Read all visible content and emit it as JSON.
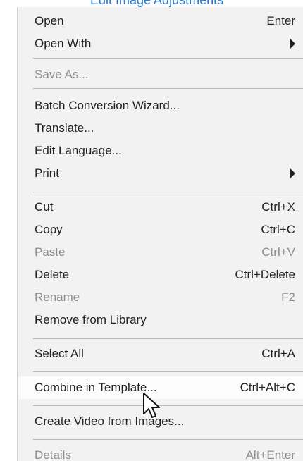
{
  "header_text": "Edit Image Adjustments",
  "menu": {
    "items": [
      {
        "label": "Open",
        "shortcut": "Enter"
      },
      {
        "label": "Open With",
        "submenu": true
      },
      {
        "label": "Save As...",
        "disabled": true
      },
      {
        "label": "Batch Conversion Wizard..."
      },
      {
        "label": "Translate..."
      },
      {
        "label": "Edit Language..."
      },
      {
        "label": "Print",
        "submenu": true
      },
      {
        "label": "Cut",
        "shortcut": "Ctrl+X"
      },
      {
        "label": "Copy",
        "shortcut": "Ctrl+C"
      },
      {
        "label": "Paste",
        "shortcut": "Ctrl+V",
        "disabled": true
      },
      {
        "label": "Delete",
        "shortcut": "Ctrl+Delete"
      },
      {
        "label": "Rename",
        "shortcut": "F2",
        "disabled": true
      },
      {
        "label": "Remove from Library"
      },
      {
        "label": "Select All",
        "shortcut": "Ctrl+A"
      },
      {
        "label": "Combine in Template...",
        "shortcut": "Ctrl+Alt+C",
        "hovered": true
      },
      {
        "label": "Create Video from Images..."
      },
      {
        "label": "Details",
        "shortcut": "Alt+Enter",
        "disabled": true
      }
    ]
  },
  "icons": {
    "submenu_arrow": "chevron-right-icon",
    "cursor": "mouse-pointer-icon"
  },
  "colors": {
    "menu_background": "#f2f2f2",
    "separator": "#b8b8b8",
    "text": "#222222",
    "disabled_text": "#8e8e8e",
    "hover_background": "#fcfcfc",
    "header_text": "#2a7ad0"
  }
}
